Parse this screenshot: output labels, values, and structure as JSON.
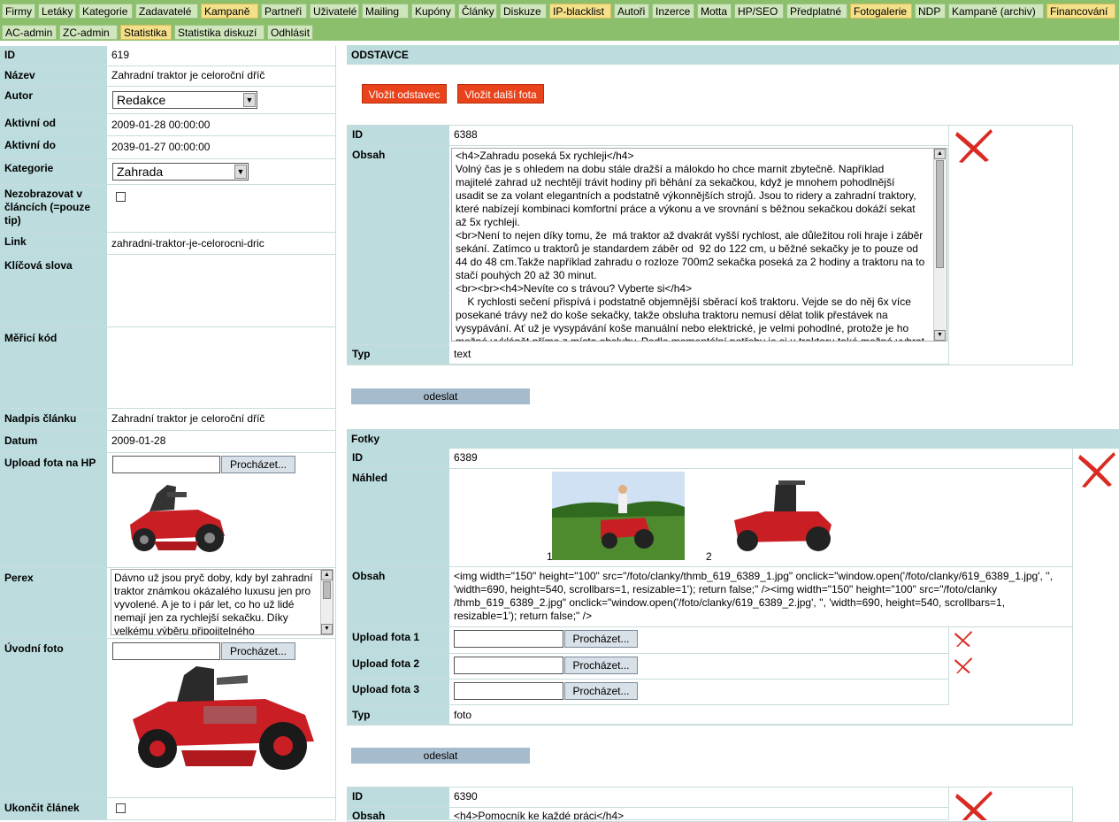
{
  "nav": {
    "row1": [
      "Firmy",
      "Letáky",
      "Kategorie",
      "Zadavatelé",
      "Kampaně",
      "Partneři",
      "Uživatelé",
      "Mailing",
      "Kupóny",
      "Články",
      "Diskuze",
      "IP-blacklist",
      "Autoři",
      "Inzerce",
      "Motta",
      "HP/SEO",
      "Předplatné",
      "Fotogalerie",
      "NDP",
      "Kampaně (archiv)",
      "Financování"
    ],
    "row2": [
      "AC-admin",
      "ZC-admin",
      "Statistika",
      "Statistika diskuzí",
      "Odhlásit"
    ],
    "highlighted": [
      "Kampaně",
      "IP-blacklist",
      "Fotogalerie",
      "Financování",
      "Statistika"
    ]
  },
  "article": {
    "id_label": "ID",
    "id": "619",
    "name_label": "Název",
    "name": "Zahradní traktor je celoroční dříč",
    "author_label": "Autor",
    "author": "Redakce",
    "active_from_label": "Aktivní od",
    "active_from": "2009-01-28 00:00:00",
    "active_to_label": "Aktivní do",
    "active_to": "2039-01-27 00:00:00",
    "category_label": "Kategorie",
    "category": "Zahrada",
    "hide_label": "Nezobrazovat v článcích (=pouze tip)",
    "link_label": "Link",
    "link": "zahradni-traktor-je-celorocni-dric",
    "keywords_label": "Klíčová slova",
    "tracking_label": "Měřicí kód",
    "heading_label": "Nadpis článku",
    "heading": "Zahradní traktor je celoroční dříč",
    "date_label": "Datum",
    "date": "2009-01-28",
    "upload_hp_label": "Upload fota na HP",
    "browse": "Procházet...",
    "perex_label": "Perex",
    "perex": "Dávno už jsou pryč doby, kdy byl zahradní traktor známkou okázalého luxusu jen pro vyvolené. A je to i pár let, co ho už lidé nemají jen za rychlejší sekačku. Díky velkému výběru připojitelného",
    "intro_photo_label": "Úvodní foto",
    "end_label": "Ukončit článek"
  },
  "odstavce": {
    "title": "ODSTAVCE",
    "insert_paragraph": "Vložit odstavec",
    "insert_photos": "Vložit další fota",
    "p1": {
      "id_label": "ID",
      "id": "6388",
      "content_label": "Obsah",
      "content_lines": [
        "<h4>Zahradu poseká 5x rychleji</h4>",
        "Volný čas je s ohledem na dobu stále dražší a málokdo ho chce marnit zbytečně. Například",
        "majitelé zahrad už nechtějí trávit hodiny při běhání za sekačkou, když je mnohem pohodlnější",
        "usadit se za volant elegantních a podstatně výkonnějších strojů. Jsou to ridery a zahradní traktory,",
        "které nabízejí kombinaci komfortní práce a výkonu a ve srovnání s běžnou sekačkou dokáží sekat",
        "až 5x rychleji.",
        "<br>Není to nejen díky tomu, že  má traktor až dvakrát vyšší rychlost, ale důležitou roli hraje i záběr",
        "sekání. Zatímco u traktorů je standardem záběr od  92 do 122 cm, u běžné sekačky je to pouze od",
        "44 do 48 cm.Takže například zahradu o rozloze 700m2 sekačka poseká za 2 hodiny a traktoru na to",
        "stačí pouhých 20 až 30 minut.",
        "<br><br><h4>Nevíte co s trávou? Vyberte si</h4>",
        "    K rychlosti sečení přispívá i podstatně objemnější sběrací koš traktoru. Vejde se do něj 6x více",
        "posekané trávy než do koše sekačky, takže obsluha traktoru nemusí dělat tolik přestávek na",
        "vysypávání. Ať už je vysypávání koše manuální nebo elektrické, je velmi pohodlné, protože je ho",
        "možné vyklápět přímo z místa obsluhy. Podle momentální potřeby je si u traktoru také možné vybrat"
      ],
      "type_label": "Typ",
      "type": "text"
    },
    "submit": "odeslat",
    "fotky": {
      "title": "Fotky",
      "id_label": "ID",
      "id": "6389",
      "preview_label": "Náhled",
      "thumb1_num": "1",
      "thumb2_num": "2",
      "content_label": "Obsah",
      "content_lines": [
        "<img width=\"150\" height=\"100\" src=\"/foto/clanky/thmb_619_6389_1.jpg\" onclick=\"window.open('/foto/clanky/619_6389_1.jpg', '',",
        "'width=690, height=540, scrollbars=1, resizable=1'); return false;\" /><img width=\"150\" height=\"100\" src=\"/foto/clanky",
        "/thmb_619_6389_2.jpg\" onclick=\"window.open('/foto/clanky/619_6389_2.jpg', '', 'width=690, height=540, scrollbars=1,",
        "resizable=1'); return false;\" />"
      ],
      "upload1_label": "Upload fota 1",
      "upload2_label": "Upload fota 2",
      "upload3_label": "Upload fota 3",
      "type_label": "Typ",
      "type": "foto"
    },
    "p3": {
      "id_label": "ID",
      "id": "6390",
      "content_label": "Obsah",
      "content_first": "<h4>Pomocník ke každé práci</h4>"
    }
  },
  "colors": {
    "nav_bg": "#8cbf6b",
    "label_bg": "#bcdcdd",
    "accent_red": "#e8431a",
    "highlight": "#f5e08a"
  }
}
